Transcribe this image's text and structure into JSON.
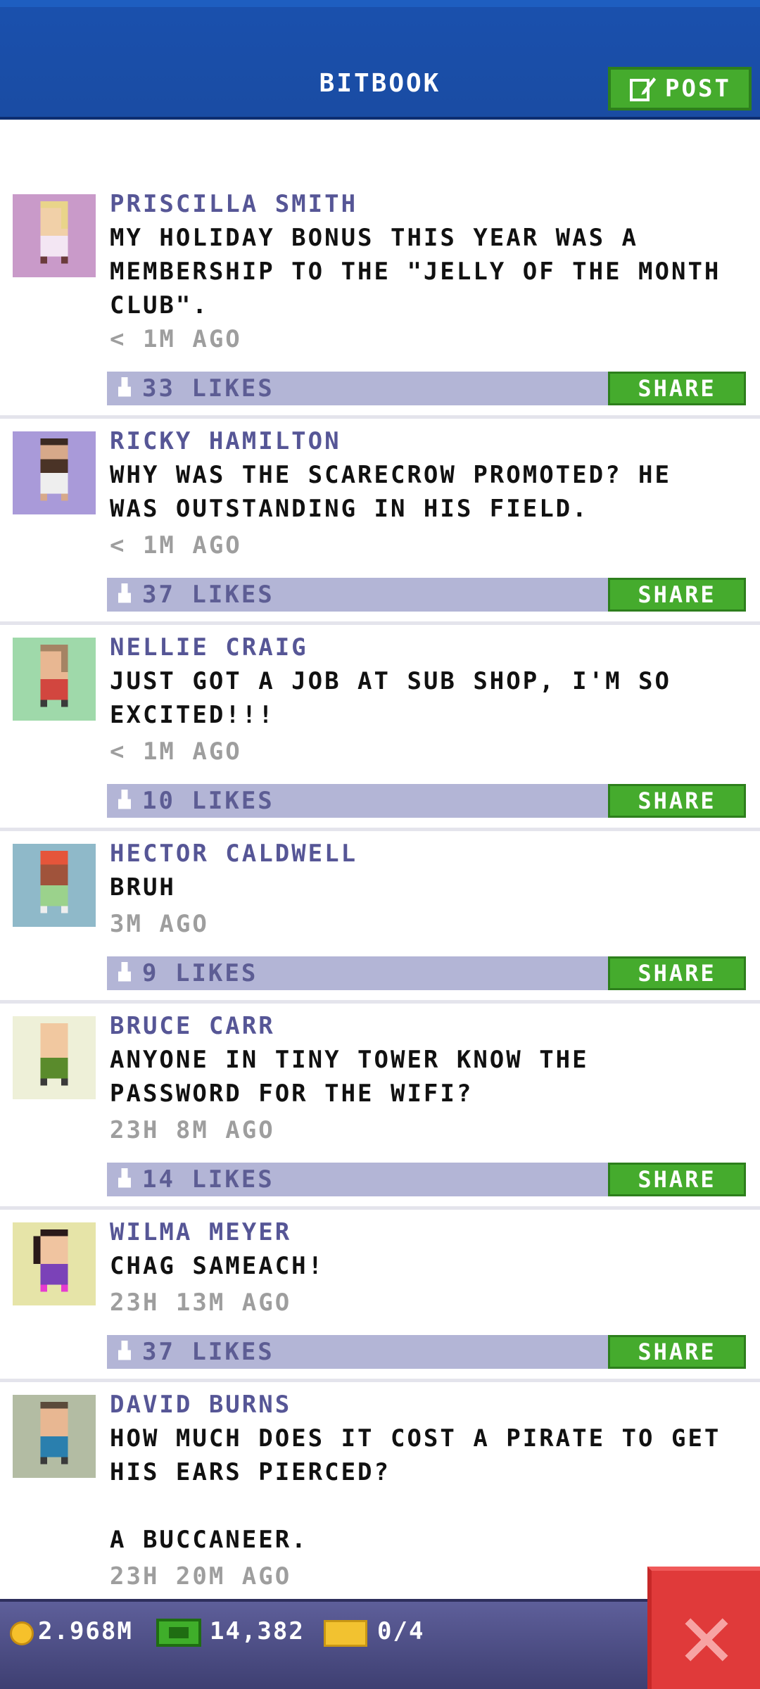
{
  "header": {
    "title": "BITBOOK",
    "post_label": "POST"
  },
  "posts": [
    {
      "author": "PRISCILLA SMITH",
      "message": "MY HOLIDAY BONUS THIS YEAR WAS A\nMEMBERSHIP TO THE \"JELLY OF THE MONTH\nCLUB\".",
      "time": "< 1M AGO",
      "likes": "33 LIKES",
      "share_label": "SHARE",
      "avatar_bg": "#c99ac9"
    },
    {
      "author": "RICKY HAMILTON",
      "message": "WHY WAS THE SCARECROW PROMOTED? HE\nWAS OUTSTANDING IN HIS FIELD.",
      "time": "< 1M AGO",
      "likes": "37 LIKES",
      "share_label": "SHARE",
      "avatar_bg": "#a99ad9"
    },
    {
      "author": "NELLIE CRAIG",
      "message": "JUST GOT A JOB AT SUB SHOP, I'M SO\nEXCITED!!!",
      "time": "< 1M AGO",
      "likes": "10 LIKES",
      "share_label": "SHARE",
      "avatar_bg": "#9fd9aa"
    },
    {
      "author": "HECTOR CALDWELL",
      "message": "BRUH",
      "time": "3M AGO",
      "likes": "9 LIKES",
      "share_label": "SHARE",
      "avatar_bg": "#8fb9c9"
    },
    {
      "author": "BRUCE CARR",
      "message": "ANYONE IN TINY TOWER KNOW THE\nPASSWORD FOR THE WIFI?",
      "time": "23H 8M AGO",
      "likes": "14 LIKES",
      "share_label": "SHARE",
      "avatar_bg": "#eef0d8"
    },
    {
      "author": "WILMA MEYER",
      "message": "CHAG SAMEACH!",
      "time": "23H 13M AGO",
      "likes": "37 LIKES",
      "share_label": "SHARE",
      "avatar_bg": "#e6e4a8"
    },
    {
      "author": "DAVID BURNS",
      "message": "HOW MUCH DOES IT COST A PIRATE TO GET\nHIS EARS PIERCED?\n\nA BUCCANEER.",
      "time": "23H 20M AGO",
      "likes": "",
      "share_label": "SHARE",
      "avatar_bg": "#b3bca3"
    }
  ],
  "bottom_bar": {
    "coins": "2.968M",
    "bux": "14,382",
    "tickets": "0/4"
  },
  "colors": {
    "header": "#1a4ca3",
    "accent_green": "#45ab2d",
    "like_bar": "#b3b5d6",
    "author_text": "#565696",
    "close_red": "#e03a3a"
  }
}
